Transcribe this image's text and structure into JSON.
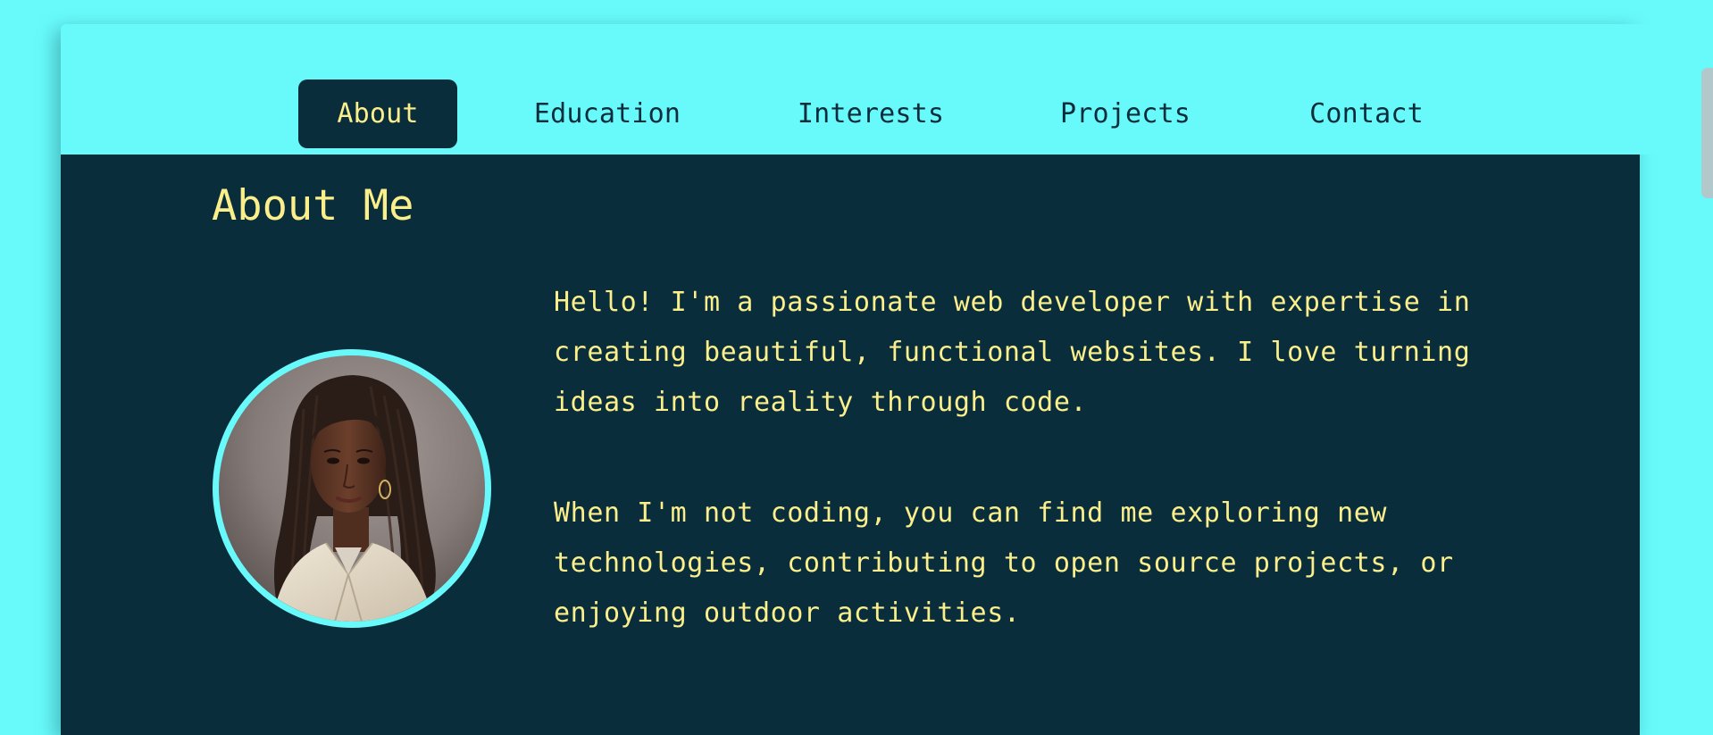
{
  "nav": {
    "items": [
      {
        "label": "About",
        "active": true
      },
      {
        "label": "Education",
        "active": false
      },
      {
        "label": "Interests",
        "active": false
      },
      {
        "label": "Projects",
        "active": false
      },
      {
        "label": "Contact",
        "active": false
      }
    ]
  },
  "about": {
    "heading": "About Me",
    "paragraphs": [
      "Hello! I'm a passionate web developer with expertise in creating beautiful, functional websites. I love turning ideas into reality through code.",
      "When I'm not coding, you can find me exploring new technologies, contributing to open source projects, or enjoying outdoor activities."
    ]
  },
  "colors": {
    "page_background": "#68fafb",
    "content_background": "#0a2d3c",
    "accent_text": "#fbef8c",
    "nav_text": "#0b2d3b",
    "avatar_ring": "#68fafb"
  }
}
